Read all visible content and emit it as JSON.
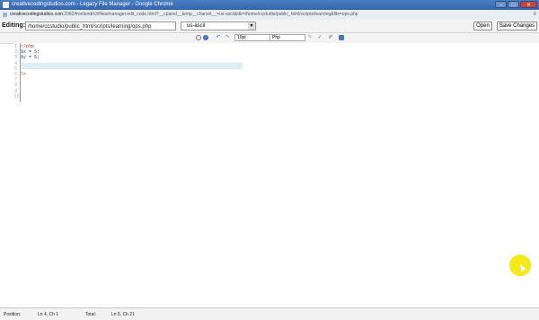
{
  "window": {
    "title": "creativecodingstudios.com - Legacy File Manager - Google Chrome",
    "minimize": "–",
    "maximize": "□",
    "close": "✕"
  },
  "browser": {
    "url_domain": "creativecodingstudios.com",
    "url_rest": ":2082/frontend/x3/files/manager.edit_code.html?__cpanel__temp__charset__=us-ascii&dir=/home/ccstudio/public_html/scripts/learning&file=ops.php",
    "menu_icon": "≡"
  },
  "editbar": {
    "label": "Editing:",
    "path": "/home/ccstudio/public_html/scripts/learning/ops.php",
    "encoding": "us-ascii",
    "open_label": "Open",
    "save_label": "Save Changes"
  },
  "toolbar": {
    "font_size": "10pt",
    "syntax": "Php"
  },
  "editor": {
    "line_numbers": [
      "1",
      "2",
      "3",
      "4",
      "5",
      "6",
      "7",
      "8",
      "9",
      "10"
    ],
    "lines": [
      {
        "text": "<?php",
        "kind": "tag"
      },
      {
        "text": "$x = 5;",
        "kind": "code"
      },
      {
        "text": "$y = 5;",
        "kind": "code"
      },
      {
        "text": "",
        "kind": "code"
      },
      {
        "text": "",
        "kind": "code"
      },
      {
        "text": "?>",
        "kind": "tag"
      }
    ]
  },
  "status": {
    "position_label": "Position:",
    "position_value": "Ln 4, Ch 1",
    "total_label": "Total:",
    "total_value": "Ln 6, Ch 21"
  },
  "colors": {
    "titlebar": "#3d6fb8",
    "current_line": "#dbeef6",
    "highlight_cursor": "#f2e600"
  }
}
